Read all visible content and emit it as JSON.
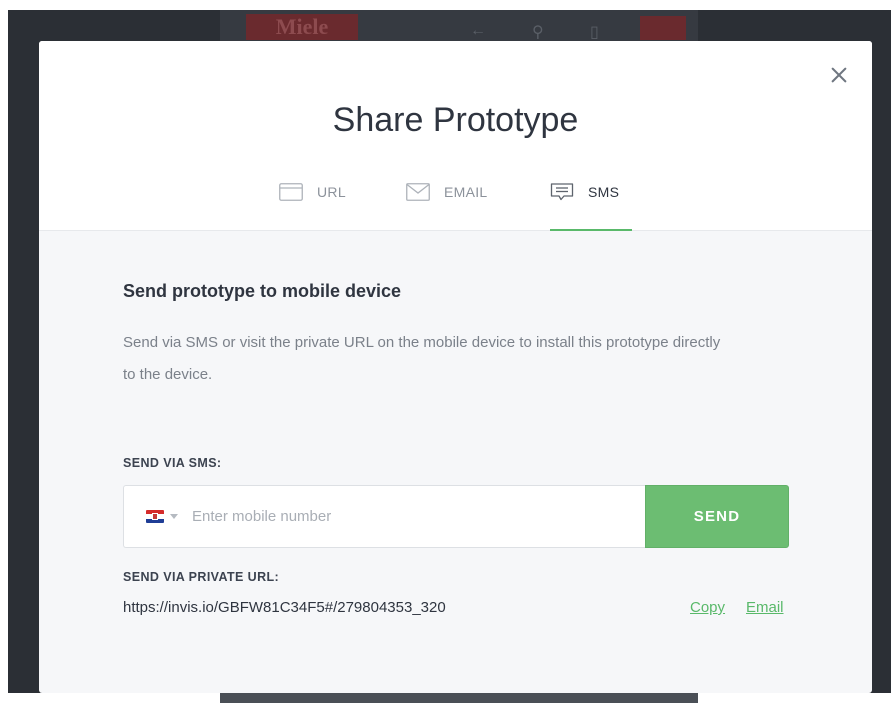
{
  "background": {
    "logo": "Miele",
    "icons": [
      "arrow-left-icon",
      "search-icon",
      "cart-icon",
      "menu-icon"
    ]
  },
  "modal": {
    "title": "Share Prototype",
    "close_icon": "close-icon",
    "tabs": [
      {
        "label": "URL",
        "icon": "browser-window-icon",
        "active": false
      },
      {
        "label": "EMAIL",
        "icon": "envelope-icon",
        "active": false
      },
      {
        "label": "SMS",
        "icon": "chat-bubble-icon",
        "active": true
      }
    ],
    "section_title": "Send prototype to mobile device",
    "description": "Send via SMS or visit the private URL on the mobile device to install this prototype directly to the device.",
    "sms": {
      "label": "SEND VIA SMS:",
      "country": "Croatia",
      "phone_value": "",
      "phone_placeholder": "Enter mobile number",
      "send_label": "SEND"
    },
    "private_url": {
      "label": "SEND VIA PRIVATE URL:",
      "url": "https://invis.io/GBFW81C34F5#/279804353_320",
      "copy_label": "Copy",
      "email_label": "Email"
    }
  },
  "colors": {
    "accent": "#59b96a",
    "send_button": "#6cbd72",
    "backdrop": "#2b2f35",
    "text_primary": "#2f3540",
    "text_muted": "#7b818a"
  }
}
